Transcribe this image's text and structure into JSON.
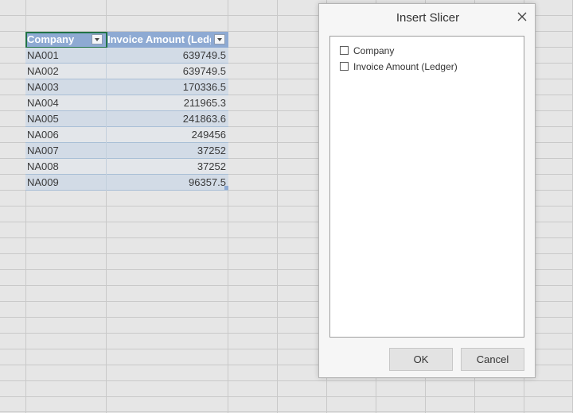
{
  "table": {
    "headers": [
      "Company",
      "Invoice Amount (Ledger)"
    ],
    "rows": [
      [
        "NA001",
        "639749.5"
      ],
      [
        "NA002",
        "639749.5"
      ],
      [
        "NA003",
        "170336.5"
      ],
      [
        "NA004",
        "211965.3"
      ],
      [
        "NA005",
        "241863.6"
      ],
      [
        "NA006",
        "249456"
      ],
      [
        "NA007",
        "37252"
      ],
      [
        "NA008",
        "37252"
      ],
      [
        "NA009",
        "96357.5"
      ]
    ]
  },
  "dialog": {
    "title": "Insert Slicer",
    "fields": [
      {
        "label": "Company",
        "checked": false
      },
      {
        "label": "Invoice Amount (Ledger)",
        "checked": false
      }
    ],
    "ok_label": "OK",
    "cancel_label": "Cancel"
  },
  "colors": {
    "header_bg": "#8eaad3",
    "band_row": "#d2dbe6",
    "active_cell_border": "#217346"
  },
  "icons": [
    "filter-dropdown-icon",
    "close-icon",
    "checkbox-icon"
  ]
}
